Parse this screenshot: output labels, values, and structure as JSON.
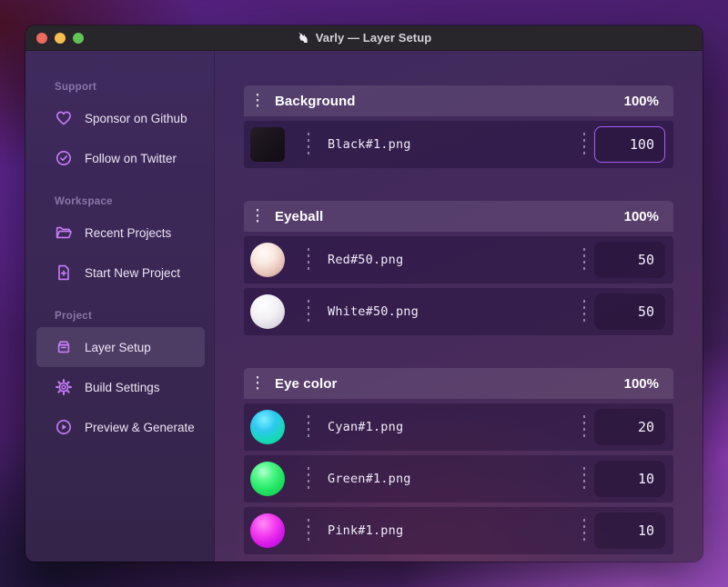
{
  "window": {
    "title": "Varly — Layer Setup"
  },
  "sidebar": {
    "sections": [
      {
        "label": "Support",
        "items": [
          {
            "icon": "heart-icon",
            "label": "Sponsor on Github"
          },
          {
            "icon": "check-badge-icon",
            "label": "Follow on Twitter"
          }
        ]
      },
      {
        "label": "Workspace",
        "items": [
          {
            "icon": "folder-icon",
            "label": "Recent Projects"
          },
          {
            "icon": "file-plus-icon",
            "label": "Start New Project"
          }
        ]
      },
      {
        "label": "Project",
        "items": [
          {
            "icon": "archive-box-icon",
            "label": "Layer Setup",
            "active": true
          },
          {
            "icon": "gear-icon",
            "label": "Build Settings"
          },
          {
            "icon": "play-circle-icon",
            "label": "Preview & Generate"
          }
        ]
      }
    ]
  },
  "layers": {
    "groups": [
      {
        "name": "Background",
        "weight": "100%",
        "rows": [
          {
            "file": "Black#1.png",
            "value": "100",
            "thumb": "black-square",
            "focused": true
          }
        ]
      },
      {
        "name": "Eyeball",
        "weight": "100%",
        "rows": [
          {
            "file": "Red#50.png",
            "value": "50",
            "thumb": "red-ball"
          },
          {
            "file": "White#50.png",
            "value": "50",
            "thumb": "white-ball"
          }
        ]
      },
      {
        "name": "Eye color",
        "weight": "100%",
        "rows": [
          {
            "file": "Cyan#1.png",
            "value": "20",
            "thumb": "cyan-ball"
          },
          {
            "file": "Green#1.png",
            "value": "10",
            "thumb": "green-ball"
          },
          {
            "file": "Pink#1.png",
            "value": "10",
            "thumb": "pink-ball"
          }
        ]
      }
    ]
  },
  "colors": {
    "accent": "#a95cf5",
    "sidebar_icon": "#c77dfa",
    "titlebar": "#29262b",
    "traffic_red": "#ee6a5e",
    "traffic_yellow": "#f6bd50",
    "traffic_green": "#62c454"
  }
}
